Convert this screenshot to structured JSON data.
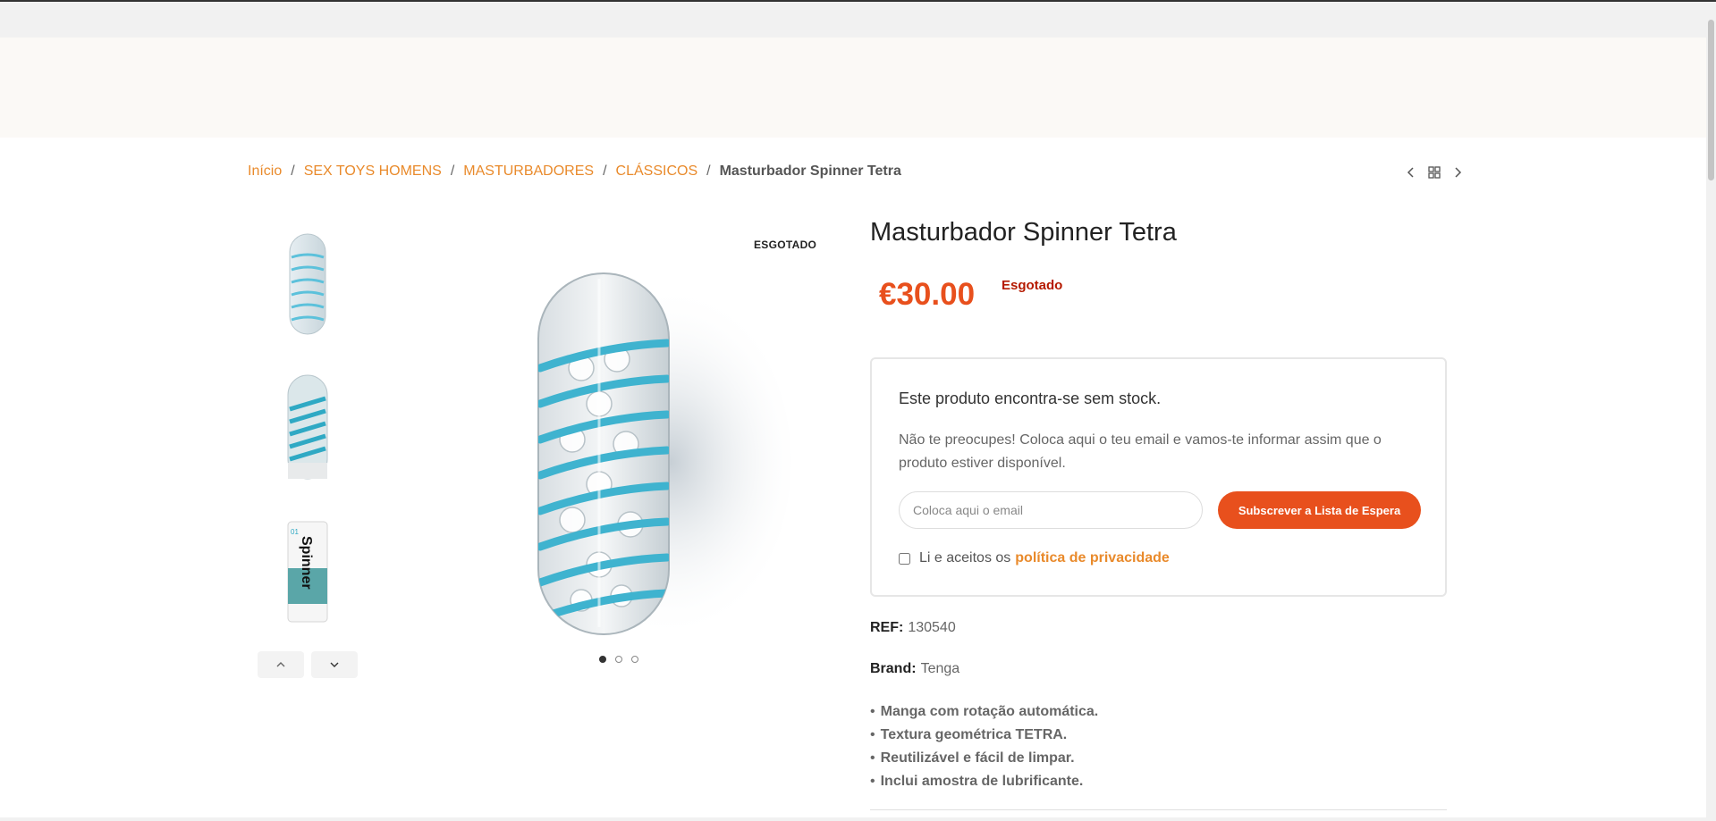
{
  "breadcrumb": {
    "items": [
      "Início",
      "SEX TOYS HOMENS",
      "MASTURBADORES",
      "CLÁSSICOS"
    ],
    "separator": "/",
    "current": "Masturbador Spinner Tetra"
  },
  "product_nav": {
    "icons": [
      "chevron-left-icon",
      "grid-icon",
      "chevron-right-icon"
    ]
  },
  "gallery": {
    "badge": "ESGOTADO",
    "thumbnails": [
      "front-view",
      "spiral-side-view",
      "packaging-view"
    ],
    "thumb_pack_text": "Spinner",
    "thumb_pack_number": "01",
    "dots": 3,
    "active_dot": 0
  },
  "product": {
    "title": "Masturbador Spinner Tetra",
    "price": "€30.00",
    "stock_status": "Esgotado"
  },
  "waitlist": {
    "title": "Este produto encontra-se sem stock.",
    "description": "Não te preocupes! Coloca aqui o teu email e vamos-te informar assim que o produto estiver disponível.",
    "email_placeholder": "Coloca aqui o email",
    "button_label": "Subscrever a Lista de Espera",
    "consent_text": "Li e aceitos os",
    "consent_link": "política de privacidade"
  },
  "meta": {
    "ref_label": "REF:",
    "ref_value": "130540",
    "brand_label": "Brand:",
    "brand_value": "Tenga"
  },
  "features": [
    "Manga com rotação automática.",
    "Textura geométrica TETRA.",
    "Reutilizável e fácil de limpar.",
    "Inclui amostra de lubrificante."
  ],
  "colors": {
    "accent": "#e8501d",
    "link": "#e98a2b",
    "out_of_stock": "#b51a00",
    "product_blue": "#3fb3cf"
  }
}
